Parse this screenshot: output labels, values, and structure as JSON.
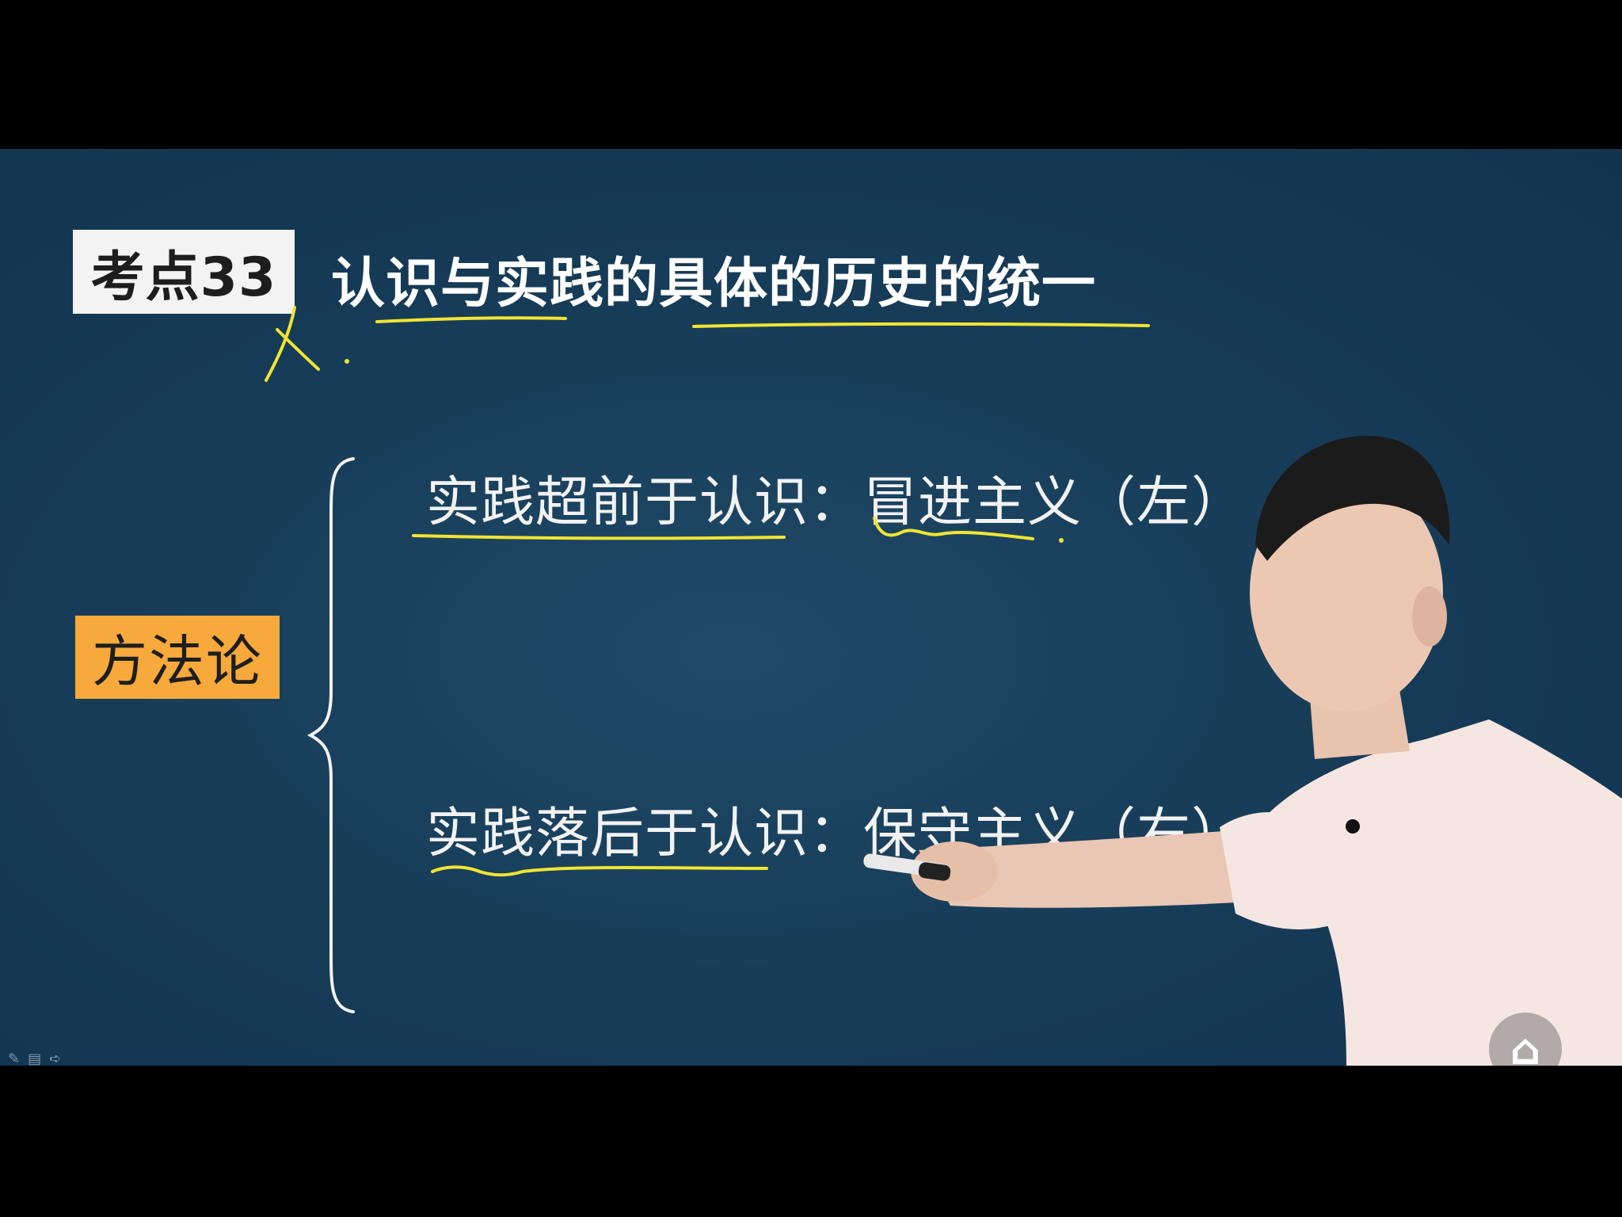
{
  "slide": {
    "tag": "考点33",
    "title": "认识与实践的具体的历史的统一",
    "method_label": "方法论",
    "items": [
      {
        "text": "实践超前于认识：冒进主义（左）"
      },
      {
        "text": "实践落后于认识：保守主义（右）"
      }
    ]
  },
  "annotations": {
    "mark": "X",
    "ink_color": "#f1e432"
  },
  "colors": {
    "board": "#173d59",
    "tag_box": "#f3f3f3",
    "method_box": "#f7a93c",
    "text": "#f2f2f2"
  },
  "player": {
    "icons": [
      "pen-icon",
      "menu-icon",
      "forward-icon"
    ]
  }
}
